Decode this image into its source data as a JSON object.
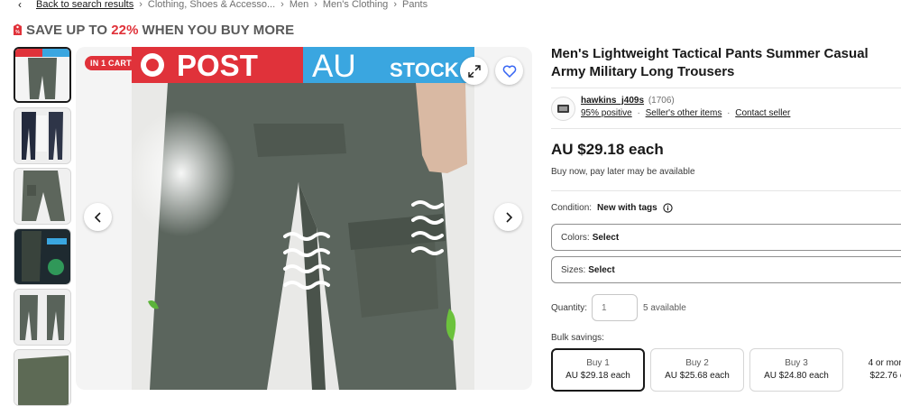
{
  "breadcrumb": {
    "back_label": "Back to search results",
    "items": [
      "Clothing, Shoes & Accesso...",
      "Men",
      "Men's Clothing",
      "Pants"
    ]
  },
  "promo": {
    "prefix": "SAVE UP TO",
    "percent": "22%",
    "suffix": "WHEN YOU BUY MORE"
  },
  "gallery": {
    "badge": "IN 1 CART",
    "banner_post": "POST",
    "banner_au": "AU",
    "banner_stock": "STOCK"
  },
  "listing": {
    "title": "Men's Lightweight Tactical Pants Summer Casual Army Military Long Trousers",
    "seller": {
      "name": "hawkins_j409s",
      "feedback_count": "(1706)",
      "positive": "95% positive",
      "other_items": "Seller's other items",
      "contact": "Contact seller"
    },
    "price": "AU $29.18 each",
    "bnpl": "Buy now, pay later may be available",
    "condition_label": "Condition:",
    "condition_value": "New with tags",
    "colors_label": "Colors:",
    "colors_value": "Select",
    "sizes_label": "Sizes:",
    "sizes_value": "Select",
    "quantity_label": "Quantity:",
    "quantity_placeholder": "1",
    "available": "5 available",
    "bulk_label": "Bulk savings:",
    "bulk": [
      {
        "qty": "Buy 1",
        "price": "AU $29.18 each"
      },
      {
        "qty": "Buy 2",
        "price": "AU $25.68 each"
      },
      {
        "qty": "Buy 3",
        "price": "AU $24.80 each"
      },
      {
        "qty": "4 or more",
        "price": "$22.76 e"
      }
    ]
  },
  "colors": {
    "accent_red": "#e0323a",
    "banner_blue": "#3aa6e0",
    "pants_green": "#59635a"
  }
}
